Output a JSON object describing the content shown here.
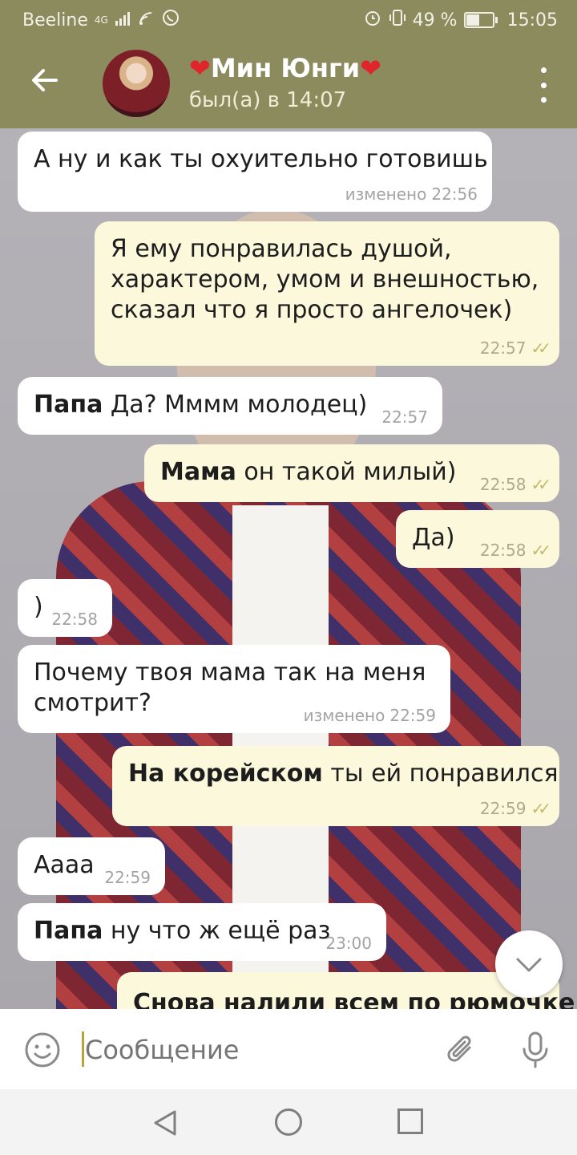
{
  "status_bar": {
    "carrier": "Beeline",
    "network": "4G",
    "battery": "49 %",
    "time": "15:05"
  },
  "header": {
    "heart_left": "❤",
    "name": "Мин Юнги",
    "heart_right": "❤",
    "status": "был(а) в 14:07"
  },
  "messages": [
    {
      "bold": "",
      "text": "А ну и как ты охуительно готовишь",
      "edited": "изменено",
      "time": "22:56"
    },
    {
      "bold": "",
      "line1": "Я ему понравилась душой,",
      "line2": "характером, умом и внешностью,",
      "line3": "сказал что я просто ангелочек)",
      "time": "22:57"
    },
    {
      "bold": "Папа",
      "text": " Да? Мммм молодец)",
      "time": "22:57"
    },
    {
      "bold": "Мама",
      "text": " он такой милый)",
      "time": "22:58"
    },
    {
      "bold": "",
      "text": "Да)",
      "time": "22:58"
    },
    {
      "bold": "",
      "text": ")",
      "time": "22:58"
    },
    {
      "bold": "",
      "line1": "Почему твоя мама так на меня",
      "line2": "смотрит?",
      "edited": "изменено",
      "time": "22:59"
    },
    {
      "bold": "На корейском",
      "text": " ты ей понравился",
      "time": "22:59"
    },
    {
      "bold": "",
      "text": "Аааа",
      "time": "22:59"
    },
    {
      "bold": "Папа",
      "text": " ну что ж ещё раз",
      "time": "23:00"
    },
    {
      "bold": "Снова налили всем по рюмочке",
      "text": ""
    }
  ],
  "input": {
    "placeholder": "Сообщение"
  },
  "icons": {
    "back": "arrow-left-icon",
    "menu": "more-vertical-icon",
    "emoji": "smile-icon",
    "attach": "paperclip-icon",
    "mic": "microphone-icon",
    "scroll": "chevron-down-icon",
    "read": "double-check-icon"
  },
  "colors": {
    "header": "#8c8b5d",
    "incoming_bubble": "#ffffff",
    "outgoing_bubble": "#fbf8dc",
    "read_check": "#c6b86a"
  }
}
